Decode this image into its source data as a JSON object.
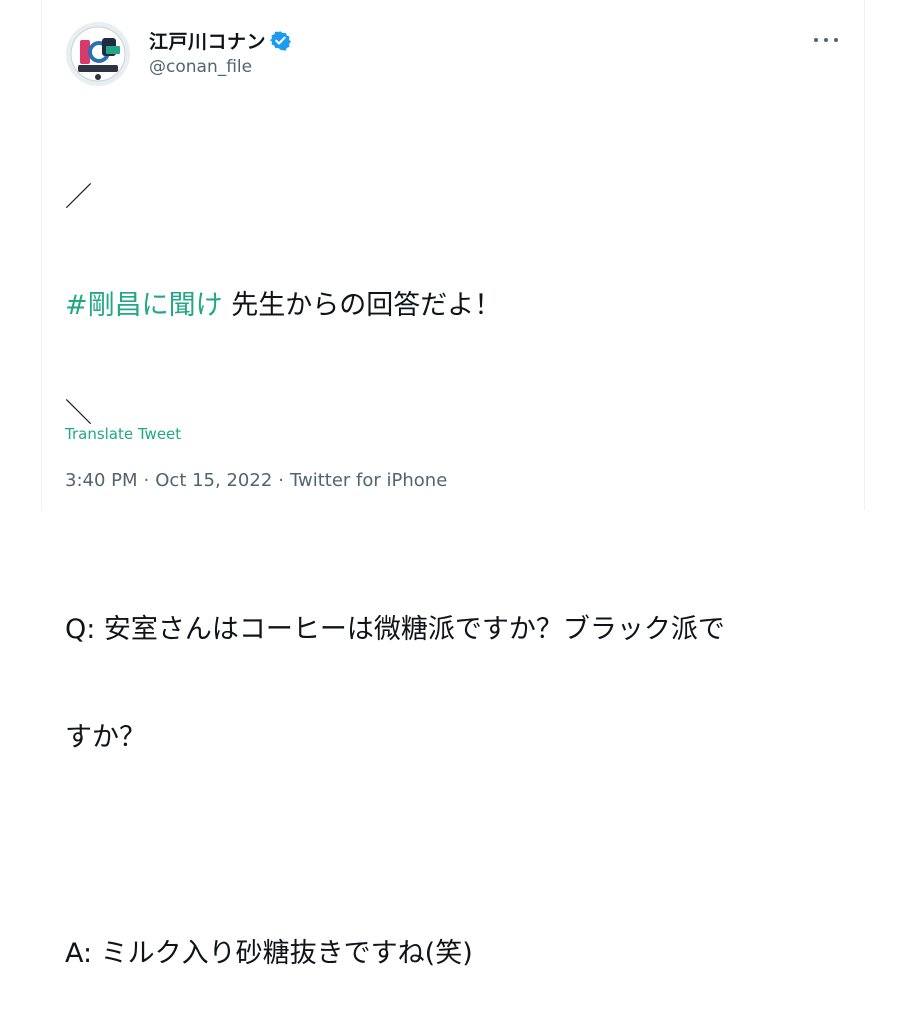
{
  "author": {
    "display_name": "江戸川コナン",
    "handle": "@conan_file",
    "verified": true,
    "avatar_icon": "anniversary-logo-avatar"
  },
  "tweet": {
    "line1": "／",
    "hashtag": "#剛昌に聞け",
    "line2_rest": " 先生からの回答だよ！",
    "line3": "＼",
    "line5": "Q: 安室さんはコーヒーは微糖派ですか？ブラック派で",
    "line6": "すか？",
    "line8": "A: ミルク入り砂糖抜きですね(笑)"
  },
  "translate_label": "Translate Tweet",
  "meta": {
    "time": "3:40 PM",
    "separator": "·",
    "date": "Oct 15, 2022",
    "source": "Twitter for iPhone"
  },
  "colors": {
    "accent": "#22a884",
    "verified": "#1d9bf0",
    "secondary_text": "#536471"
  }
}
